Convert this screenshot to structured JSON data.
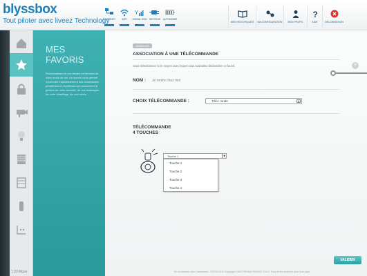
{
  "header": {
    "logo": "blyssbox",
    "tagline": "Tout piloter avec liveez Technology",
    "status": [
      {
        "label": "ETHERNET",
        "icon": "ethernet-icon"
      },
      {
        "label": "WIFI",
        "icon": "wifi-icon"
      },
      {
        "label": "SIGNAL GSM",
        "icon": "signal-icon"
      },
      {
        "label": "SECTEUR",
        "icon": "plug-icon"
      },
      {
        "label": "AUTONOMIE",
        "icon": "battery-icon"
      }
    ],
    "nav": [
      {
        "label": "MES HISTORIQUES",
        "icon": "book-icon"
      },
      {
        "label": "MA CONFIGURATION",
        "icon": "config-icon"
      },
      {
        "label": "MON PROFIL",
        "icon": "user-icon"
      },
      {
        "label": "AIDE",
        "icon": "help-icon"
      },
      {
        "label": "DÉCONNEXION",
        "icon": "power-icon"
      }
    ]
  },
  "sidebar": {
    "items": [
      {
        "name": "house-icon"
      },
      {
        "name": "star-icon",
        "active": true
      },
      {
        "name": "lock-icon"
      },
      {
        "name": "camera-icon"
      },
      {
        "name": "bulb-icon"
      },
      {
        "name": "shutter-icon"
      },
      {
        "name": "blinds-icon"
      },
      {
        "name": "thermo-icon"
      },
      {
        "name": "socket-icon"
      }
    ],
    "version": "1.03 Mgas"
  },
  "panel": {
    "title": "MES FAVORIS",
    "description": "Personnalisez ici vos favoris en fonction de votre mode de vie. Un favoris vous permet d'exécuter instantanément des commandes prédéfinies et répétitives qui concernent la gestion de votre sécurité, de vos éclairages, de votre chauffage, de vos volets..."
  },
  "main": {
    "back_label": "ANNULER",
    "title": "ASSOCIATION À UNE TÉLÉCOMMANDE",
    "description": "Vous sélectionnez ici le moyen avec lequel vous souhaitez déclencher ce favori.",
    "nom_label": "NOM :",
    "nom_value": "Je rentre chez moi",
    "choix_label": "CHOIX TÉLÉCOMMANDE :",
    "choix_value": "Télec ronde",
    "remote_title_line1": "TÉLÉCOMMANDE",
    "remote_title_line2": "4 TOUCHES",
    "touche_selected": "Touche 1",
    "touche_options": [
      "Touche 1",
      "Touche 2",
      "Touche 3",
      "Touche 4"
    ],
    "validate_label": "VALIDER",
    "footer": "En exclusivité chez Castorama - ©2010-2011 Copyright CASTORAMA FRANCE S.A.S. Tous droits réservés pour tous pays"
  },
  "colors": {
    "accent": "#1f7fb6",
    "teal": "#3fb0b3",
    "active_item": "#5ac2c2"
  }
}
